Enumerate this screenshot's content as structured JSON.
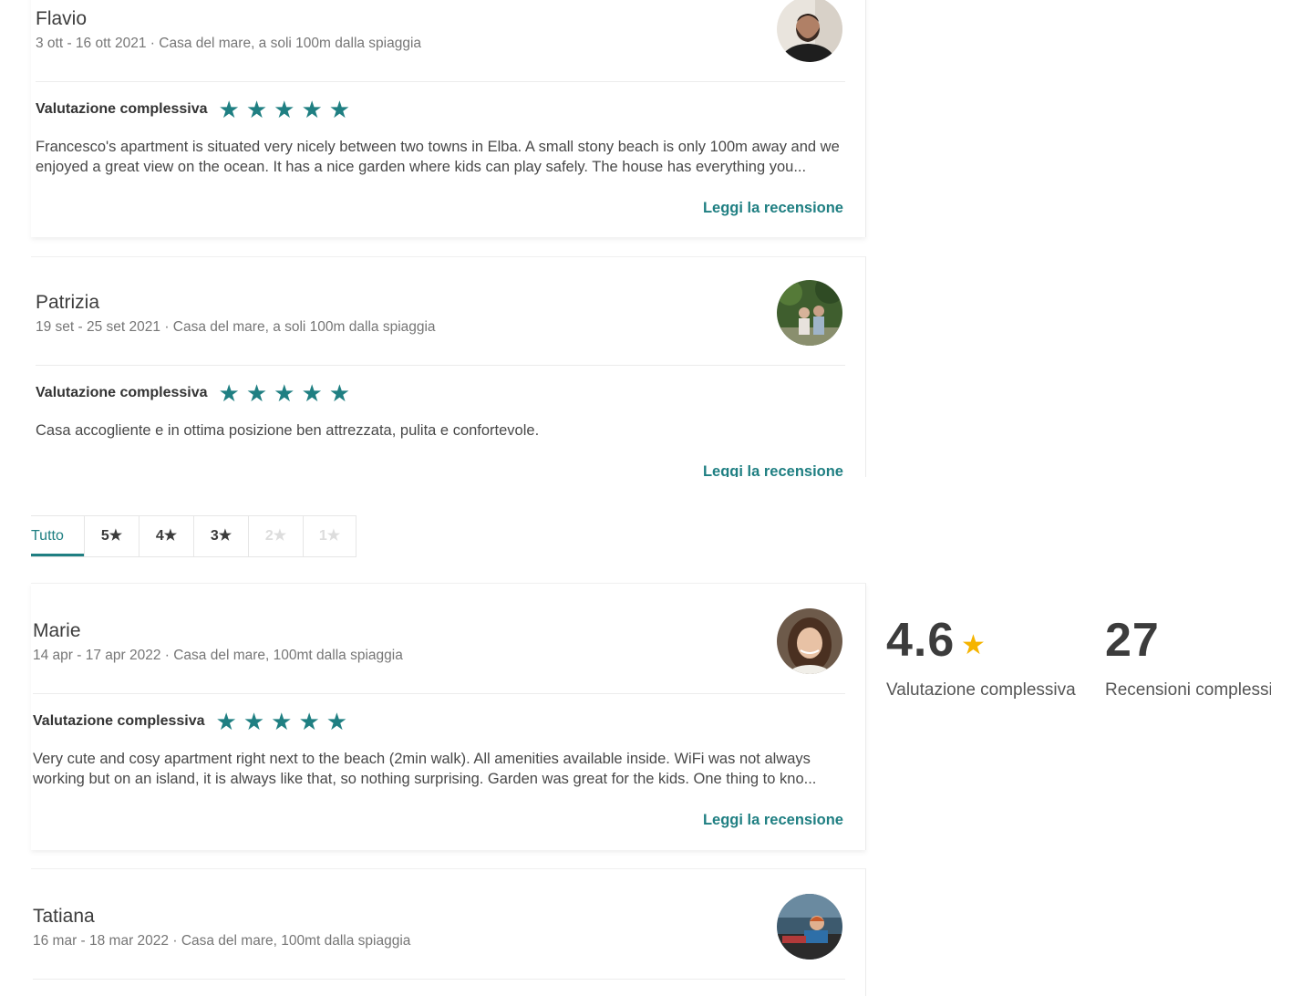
{
  "reviews_top": [
    {
      "name": "Flavio",
      "meta": "3 ott - 16 ott 2021 · Casa del mare, a soli 100m dalla spiaggia",
      "rating_label": "Valutazione complessiva",
      "stars": 5,
      "text": "Francesco's apartment is situated very nicely between two towns in Elba. A small stony beach is only 100m away and we enjoyed a great view on the ocean. It has a nice garden where kids can play safely. The house has everything you...",
      "link": "Leggi la recensione"
    },
    {
      "name": "Patrizia",
      "meta": "19 set - 25 set 2021 · Casa del mare, a soli 100m dalla spiaggia",
      "rating_label": "Valutazione complessiva",
      "stars": 5,
      "text": "Casa accogliente e in ottima posizione ben attrezzata, pulita e confortevole.",
      "link": "Leggi la recensione"
    }
  ],
  "filter_tabs": [
    {
      "label": "Tutto",
      "state": "active"
    },
    {
      "label": "5★",
      "state": "enabled"
    },
    {
      "label": "4★",
      "state": "enabled"
    },
    {
      "label": "3★",
      "state": "enabled"
    },
    {
      "label": "2★",
      "state": "disabled"
    },
    {
      "label": "1★",
      "state": "disabled"
    }
  ],
  "reviews_bottom": [
    {
      "name": "Marie",
      "meta": "14 apr - 17 apr 2022 · Casa del mare, 100mt dalla spiaggia",
      "rating_label": "Valutazione complessiva",
      "stars": 5,
      "text": "Very cute and cosy apartment right next to the beach (2min walk). All amenities available inside. WiFi was not always working but on an island, it is always like that, so nothing surprising. Garden was great for the kids. One thing to kno...",
      "link": "Leggi la recensione"
    },
    {
      "name": "Tatiana",
      "meta": "16 mar - 18 mar 2022 · Casa del mare, 100mt dalla spiaggia"
    }
  ],
  "summary": {
    "rating_value": "4.6",
    "rating_label": "Valutazione complessiva",
    "reviews_count": "27",
    "reviews_label": "Recensioni complessive"
  },
  "colors": {
    "accent": "#1f7f82",
    "star_gold": "#f5b400"
  }
}
